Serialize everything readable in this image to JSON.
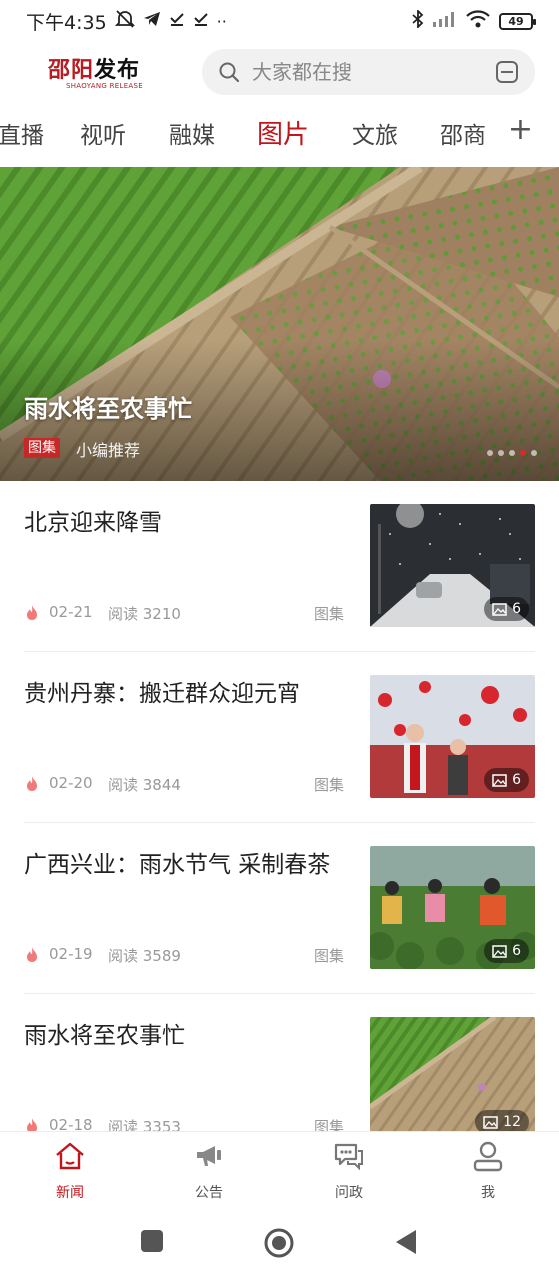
{
  "status_bar": {
    "time": "下午4:35",
    "icons_left": [
      "mute-icon",
      "telegram-icon",
      "download-done-icon",
      "download-done-icon",
      "more-dots-icon"
    ],
    "more_dots": "··",
    "icons_right": [
      "bluetooth-icon",
      "signal-icon",
      "wifi-icon"
    ],
    "battery": "49"
  },
  "header": {
    "logo_cn_red": "邵阳",
    "logo_cn_black": "发布",
    "logo_en": "SHAOYANG RELEASE",
    "search_placeholder": "大家都在搜"
  },
  "tabs": {
    "items": [
      {
        "label": "直播"
      },
      {
        "label": "视听"
      },
      {
        "label": "融媒"
      },
      {
        "label": "图片"
      },
      {
        "label": "文旅"
      },
      {
        "label": "邵商"
      }
    ],
    "active": "图片",
    "add_label": "+"
  },
  "banner": {
    "title": "雨水将至农事忙",
    "tag": "图集",
    "subtitle": "小编推荐",
    "slide_count": 5,
    "active_slide": 4
  },
  "news": [
    {
      "title": "北京迎来降雪",
      "date": "02-21",
      "reads": "阅读 3210",
      "type": "图集",
      "photo_count": "6"
    },
    {
      "title": "贵州丹寨：搬迁群众迎元宵",
      "date": "02-20",
      "reads": "阅读 3844",
      "type": "图集",
      "photo_count": "6"
    },
    {
      "title": "广西兴业：雨水节气 采制春茶",
      "date": "02-19",
      "reads": "阅读 3589",
      "type": "图集",
      "photo_count": "6"
    },
    {
      "title": "雨水将至农事忙",
      "date": "02-18",
      "reads": "阅读 3353",
      "type": "图集",
      "photo_count": "12"
    }
  ],
  "bottom_nav": {
    "items": [
      {
        "label": "新闻",
        "icon": "home-icon"
      },
      {
        "label": "公告",
        "icon": "megaphone-icon"
      },
      {
        "label": "问政",
        "icon": "chat-icon"
      },
      {
        "label": "我",
        "icon": "user-icon"
      }
    ],
    "active": "新闻"
  },
  "colors": {
    "accent": "#c0151b",
    "tag_red": "#c62828",
    "text_dark": "#222222",
    "text_muted": "#999999"
  }
}
